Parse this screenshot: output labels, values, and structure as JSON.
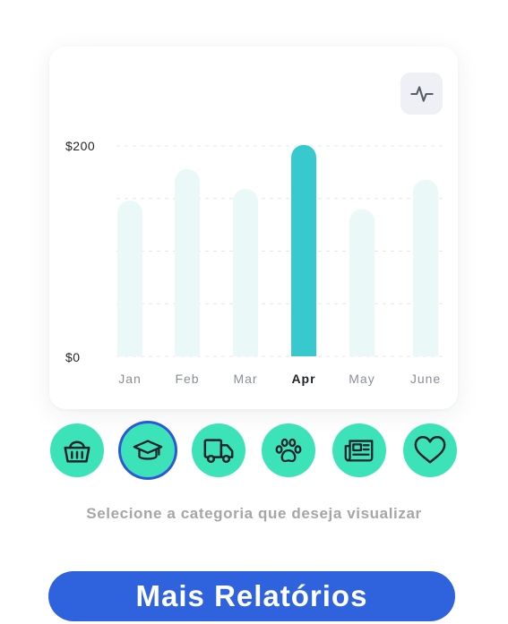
{
  "chart_data": {
    "type": "bar",
    "categories": [
      "Jan",
      "Feb",
      "Mar",
      "Apr",
      "May",
      "June"
    ],
    "values": [
      148,
      178,
      159,
      201,
      140,
      168
    ],
    "ylim": [
      0,
      200
    ],
    "y_tick_labels": [
      "$200",
      "$0"
    ],
    "highlighted_category": "Apr",
    "grid": true,
    "colors": {
      "bar": "#eaf8f7",
      "bar_highlight": "#38c9cf",
      "grid": "#e4e7ec"
    }
  },
  "toolbar": {
    "activity_icon": "activity-icon"
  },
  "categories": [
    {
      "id": "shopping",
      "icon": "basket-icon",
      "selected": false
    },
    {
      "id": "education",
      "icon": "graduation-cap-icon",
      "selected": true
    },
    {
      "id": "transport",
      "icon": "truck-icon",
      "selected": false
    },
    {
      "id": "pets",
      "icon": "paw-icon",
      "selected": false
    },
    {
      "id": "news",
      "icon": "newspaper-icon",
      "selected": false
    },
    {
      "id": "health",
      "icon": "heart-icon",
      "selected": false
    }
  ],
  "hint_text": "Selecione a categoria que deseja visualizar",
  "cta_label": "Mais Relatórios",
  "colors": {
    "accent_green": "#3de3b8",
    "accent_blue": "#2f62dd",
    "selected_ring": "#2b59d6"
  }
}
